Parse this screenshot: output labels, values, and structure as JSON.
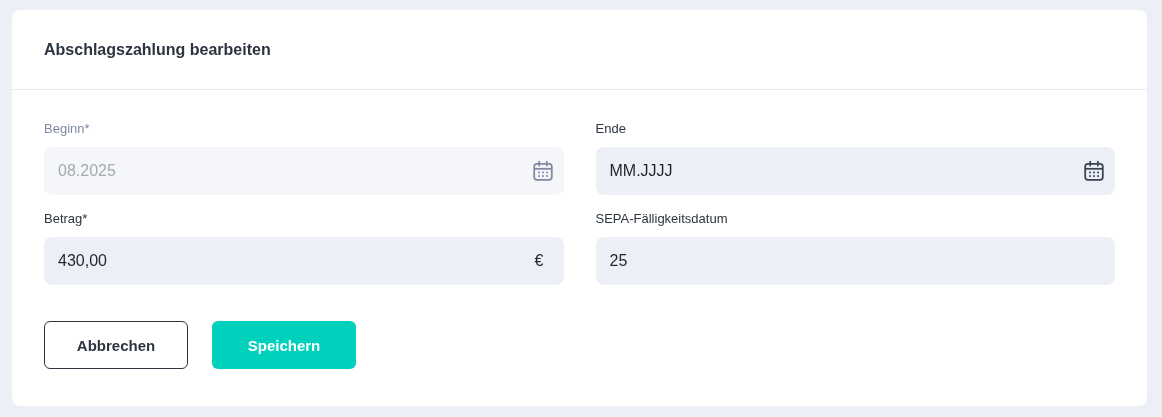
{
  "dialog": {
    "title": "Abschlagszahlung bearbeiten"
  },
  "fields": [
    {
      "label": "Beginn*",
      "value": "08.2025",
      "disabled": true,
      "kind": "date"
    },
    {
      "label": "Ende",
      "placeholder": "MM.JJJJ",
      "disabled": false,
      "kind": "date"
    },
    {
      "label": "Betrag*",
      "value": "430,00",
      "disabled": false,
      "kind": "amount",
      "suffix": "€"
    },
    {
      "label": "SEPA-Fälligkeitsdatum",
      "value": "25",
      "disabled": false,
      "kind": "text"
    }
  ],
  "buttons": [
    {
      "label": "Abbrechen",
      "kind": "secondary"
    },
    {
      "label": "Speichern",
      "kind": "primary"
    }
  ]
}
